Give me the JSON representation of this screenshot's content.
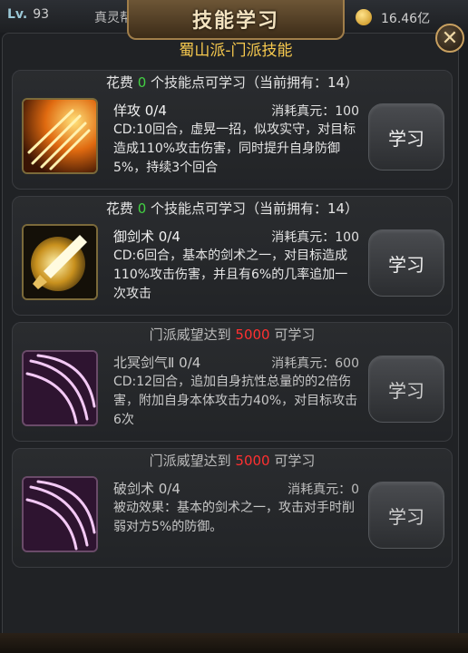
{
  "hud": {
    "level_label": "Lv.",
    "level": "93",
    "name": "真灵帮",
    "money": "16.46亿"
  },
  "title": "技能学习",
  "subtitle": "蜀山派-门派技能",
  "close_icon": "close-icon",
  "colors": {
    "green": "#43d143",
    "red": "#ff3030",
    "gold": "#f7c94e"
  },
  "skills": [
    {
      "head_pre": "花费 ",
      "head_num": "0",
      "head_post": " 个技能点可学习（当前拥有：14）",
      "name": "佯攻 0/4",
      "cost": "消耗真元：100",
      "desc": "CD:10回合，虚晃一招，似攻实守，对目标造成110%攻击伤害，同时提升自身防御5%，持续3个回合",
      "button": "学习",
      "icon": "fire-slash-icon"
    },
    {
      "head_pre": "花费 ",
      "head_num": "0",
      "head_post": " 个技能点可学习（当前拥有：14）",
      "name": "御剑术 0/4",
      "cost": "消耗真元：100",
      "desc": "CD:6回合，基本的剑术之一，对目标造成110%攻击伤害，并且有6%的几率追加一次攻击",
      "button": "学习",
      "icon": "flying-sword-icon"
    },
    {
      "head_pre": "门派威望达到 ",
      "head_num": "5000",
      "head_post": " 可学习",
      "name": "北冥剑气Ⅱ 0/4",
      "cost": "消耗真元：600",
      "desc": "CD:12回合，追加自身抗性总量的的2倍伤害，附加自身本体攻击力40%，对目标攻击6次",
      "button": "学习",
      "icon": "purple-slash-icon"
    },
    {
      "head_pre": "门派威望达到 ",
      "head_num": "5000",
      "head_post": " 可学习",
      "name": "破剑术 0/4",
      "cost": "消耗真元：0",
      "desc": "被动效果：基本的剑术之一，攻击对手时削弱对方5%的防御。",
      "button": "学习",
      "icon": "purple-slash-icon"
    }
  ]
}
